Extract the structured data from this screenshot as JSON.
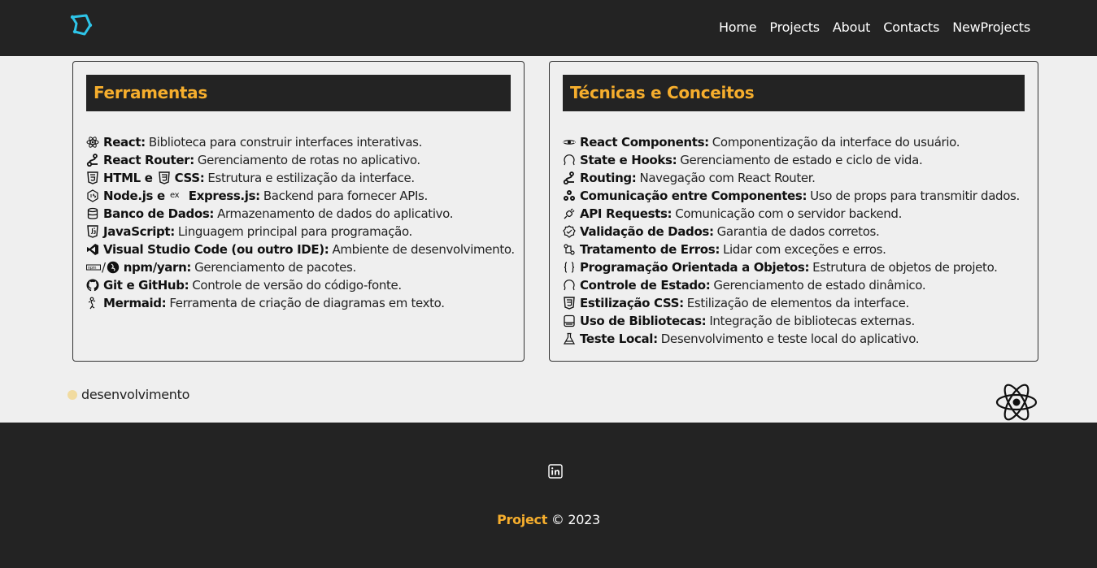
{
  "nav": {
    "links": [
      "Home",
      "Projects",
      "About",
      "Contacts",
      "NewProjects"
    ]
  },
  "tools": {
    "title": "Ferramentas",
    "items": [
      {
        "icon": "react-icon",
        "name": "React:",
        "desc": "Biblioteca para construir interfaces interativas."
      },
      {
        "icon": "router-icon",
        "name": "React Router:",
        "desc": "Gerenciamento de rotas no aplicativo."
      },
      {
        "icon": "html5-icon",
        "name": "HTML e",
        "icon2": "css3-icon",
        "name2": "CSS:",
        "desc": "Estrutura e estilização da interface."
      },
      {
        "icon": "nodejs-icon",
        "name": "Node.js e",
        "icon2": "express-icon",
        "name2": "Express.js:",
        "desc": "Backend para fornecer APIs."
      },
      {
        "icon": "database-icon",
        "name": "Banco de Dados:",
        "desc": "Armazenamento de dados do aplicativo."
      },
      {
        "icon": "javascript-icon",
        "name": "JavaScript:",
        "desc": "Linguagem principal para programação."
      },
      {
        "icon": "vscode-icon",
        "name": "Visual Studio Code (ou outro IDE):",
        "desc": "Ambiente de desenvolvimento."
      },
      {
        "icon": "npm-icon",
        "sep": "/",
        "icon2": "yarn-icon",
        "name": "npm/yarn:",
        "desc": "Gerenciamento de pacotes."
      },
      {
        "icon": "github-icon",
        "name": "Git e GitHub:",
        "desc": "Controle de versão do código-fonte."
      },
      {
        "icon": "mermaid-icon",
        "name": "Mermaid:",
        "desc": "Ferramenta de criação de diagramas em texto."
      }
    ]
  },
  "concepts": {
    "title": "Técnicas e Conceitos",
    "items": [
      {
        "icon": "component-icon",
        "name": "React Components:",
        "desc": "Componentização da interface do usuário."
      },
      {
        "icon": "hook-icon",
        "name": "State e Hooks:",
        "desc": "Gerenciamento de estado e ciclo de vida."
      },
      {
        "icon": "route-icon",
        "name": "Routing:",
        "desc": "Navegação com React Router."
      },
      {
        "icon": "network-icon",
        "name": "Comunicação entre Componentes:",
        "desc": "Uso de props para transmitir dados."
      },
      {
        "icon": "plug-icon",
        "name": "API Requests:",
        "desc": "Comunicação com o servidor backend."
      },
      {
        "icon": "badge-check-icon",
        "name": "Validação de Dados:",
        "desc": "Garantia de dados corretos."
      },
      {
        "icon": "bug-icon",
        "name": "Tratamento de Erros:",
        "desc": "Lidar com exceções e erros."
      },
      {
        "icon": "braces-icon",
        "name": "Programação Orientada a Objetos:",
        "desc": "Estrutura de objetos de projeto."
      },
      {
        "icon": "refresh-icon",
        "name": "Controle de Estado:",
        "desc": "Gerenciamento de estado dinâmico."
      },
      {
        "icon": "css3-icon",
        "name": "Estilização CSS:",
        "desc": "Estilização de elementos da interface."
      },
      {
        "icon": "library-icon",
        "name": "Uso de Bibliotecas:",
        "desc": "Integração de bibliotecas externas."
      },
      {
        "icon": "flask-icon",
        "name": "Teste Local:",
        "desc": "Desenvolvimento e teste local do aplicativo."
      }
    ]
  },
  "status": {
    "label": "desenvolvimento",
    "dot_color": "#f1dba0"
  },
  "footer": {
    "brand": "Project",
    "copyright": "© 2023",
    "social_icon": "linkedin-icon"
  },
  "colors": {
    "accent": "#f6ae2d",
    "dark": "#232323",
    "background": "#efefef",
    "logo": "#2ec4e8"
  }
}
